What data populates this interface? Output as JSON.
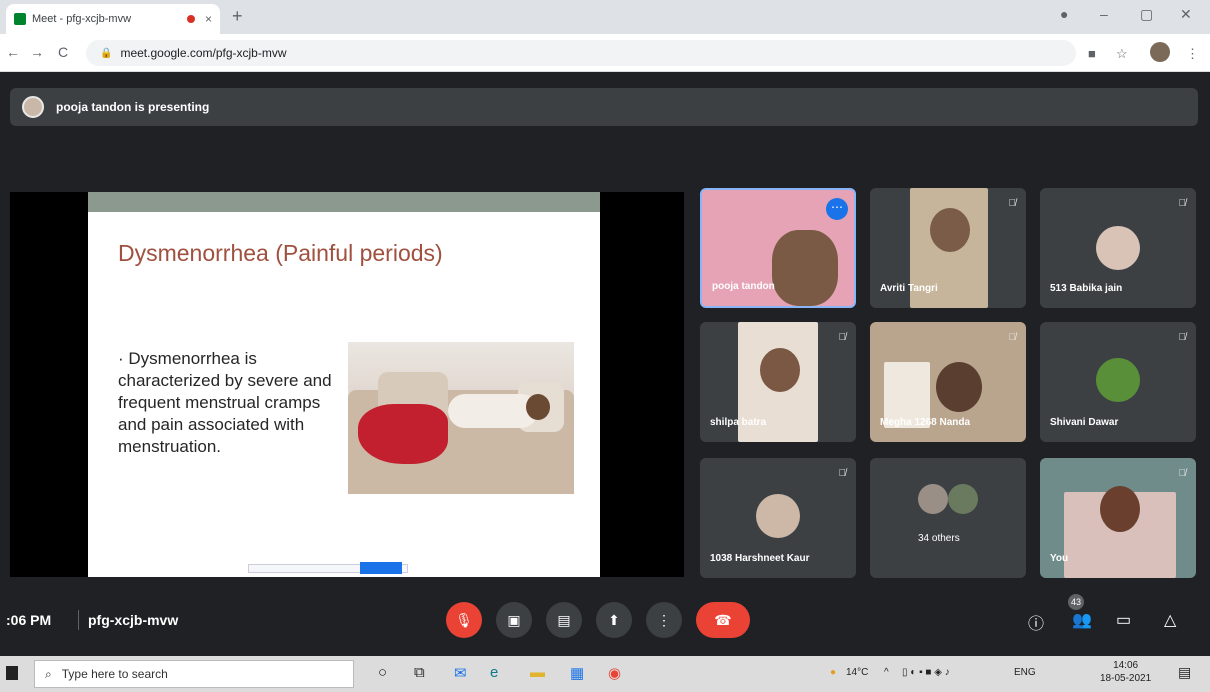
{
  "browser": {
    "tab_title": "Meet - pfg-xcjb-mvw",
    "url": "meet.google.com/pfg-xcjb-mvw",
    "new_tab": "+",
    "tab_close": "×",
    "window_controls": [
      "–",
      "▢",
      "✕"
    ]
  },
  "meet": {
    "presenting_text": "pooja tandon is presenting",
    "slide": {
      "title": "Dysmenorrhea (Painful periods)",
      "body": "· Dysmenorrhea is characterized by severe and frequent menstrual cramps and pain associated with menstruation."
    },
    "participants": [
      {
        "name": "pooja tandon",
        "muted": false,
        "active": true
      },
      {
        "name": "Avriti Tangri",
        "muted": true
      },
      {
        "name": "513 Babika jain",
        "muted": true
      },
      {
        "name": "shilpa batra",
        "muted": true
      },
      {
        "name": "Megha 1268 Nanda",
        "muted": true
      },
      {
        "name": "Shivani Dawar",
        "muted": true
      },
      {
        "name": "1038 Harshneet Kaur",
        "muted": true
      },
      {
        "name": "34 others",
        "muted": false
      },
      {
        "name": "You",
        "muted": true
      }
    ],
    "bottom": {
      "time": ":06 PM",
      "meeting_code": "pfg-xcjb-mvw",
      "people_count": "43"
    }
  },
  "taskbar": {
    "search_placeholder": "Type here to search",
    "weather": "14°C",
    "language": "ENG",
    "time": "14:06",
    "date": "18-05-2021"
  },
  "colors": {
    "meet_bg": "#202124",
    "tile_bg": "#3c4043",
    "end_call": "#ea4335",
    "active_border": "#8ab4f8"
  }
}
